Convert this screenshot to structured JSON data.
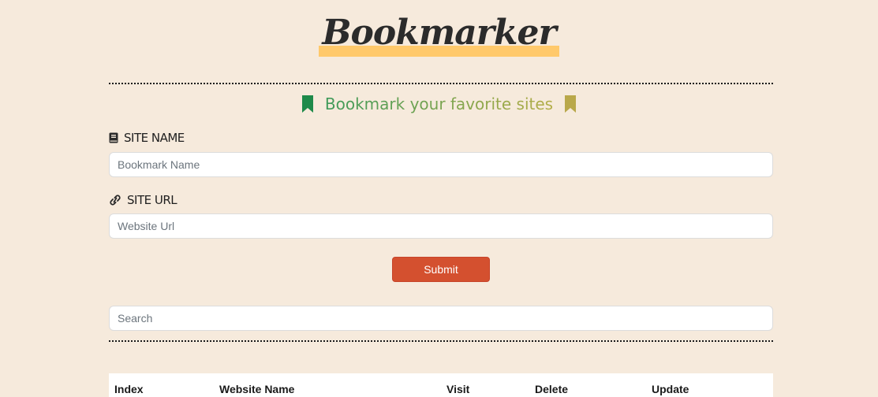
{
  "header": {
    "logo_text": "Bookmarker",
    "tagline": "Bookmark your favorite sites",
    "colors": {
      "highlight": "#ffc96b",
      "tag_green": "#3e9a5a",
      "tag_olive": "#b3ad46"
    }
  },
  "form": {
    "site_name": {
      "label": "Site Name",
      "icon": "book-icon",
      "placeholder": "Bookmark Name"
    },
    "site_url": {
      "label": "Site URL",
      "icon": "link-icon",
      "placeholder": "Website Url"
    },
    "submit_label": "Submit",
    "submit_color": "#d4502f"
  },
  "search": {
    "placeholder": "Search"
  },
  "table": {
    "columns": [
      "Index",
      "Website Name",
      "Visit",
      "Delete",
      "Update"
    ]
  }
}
